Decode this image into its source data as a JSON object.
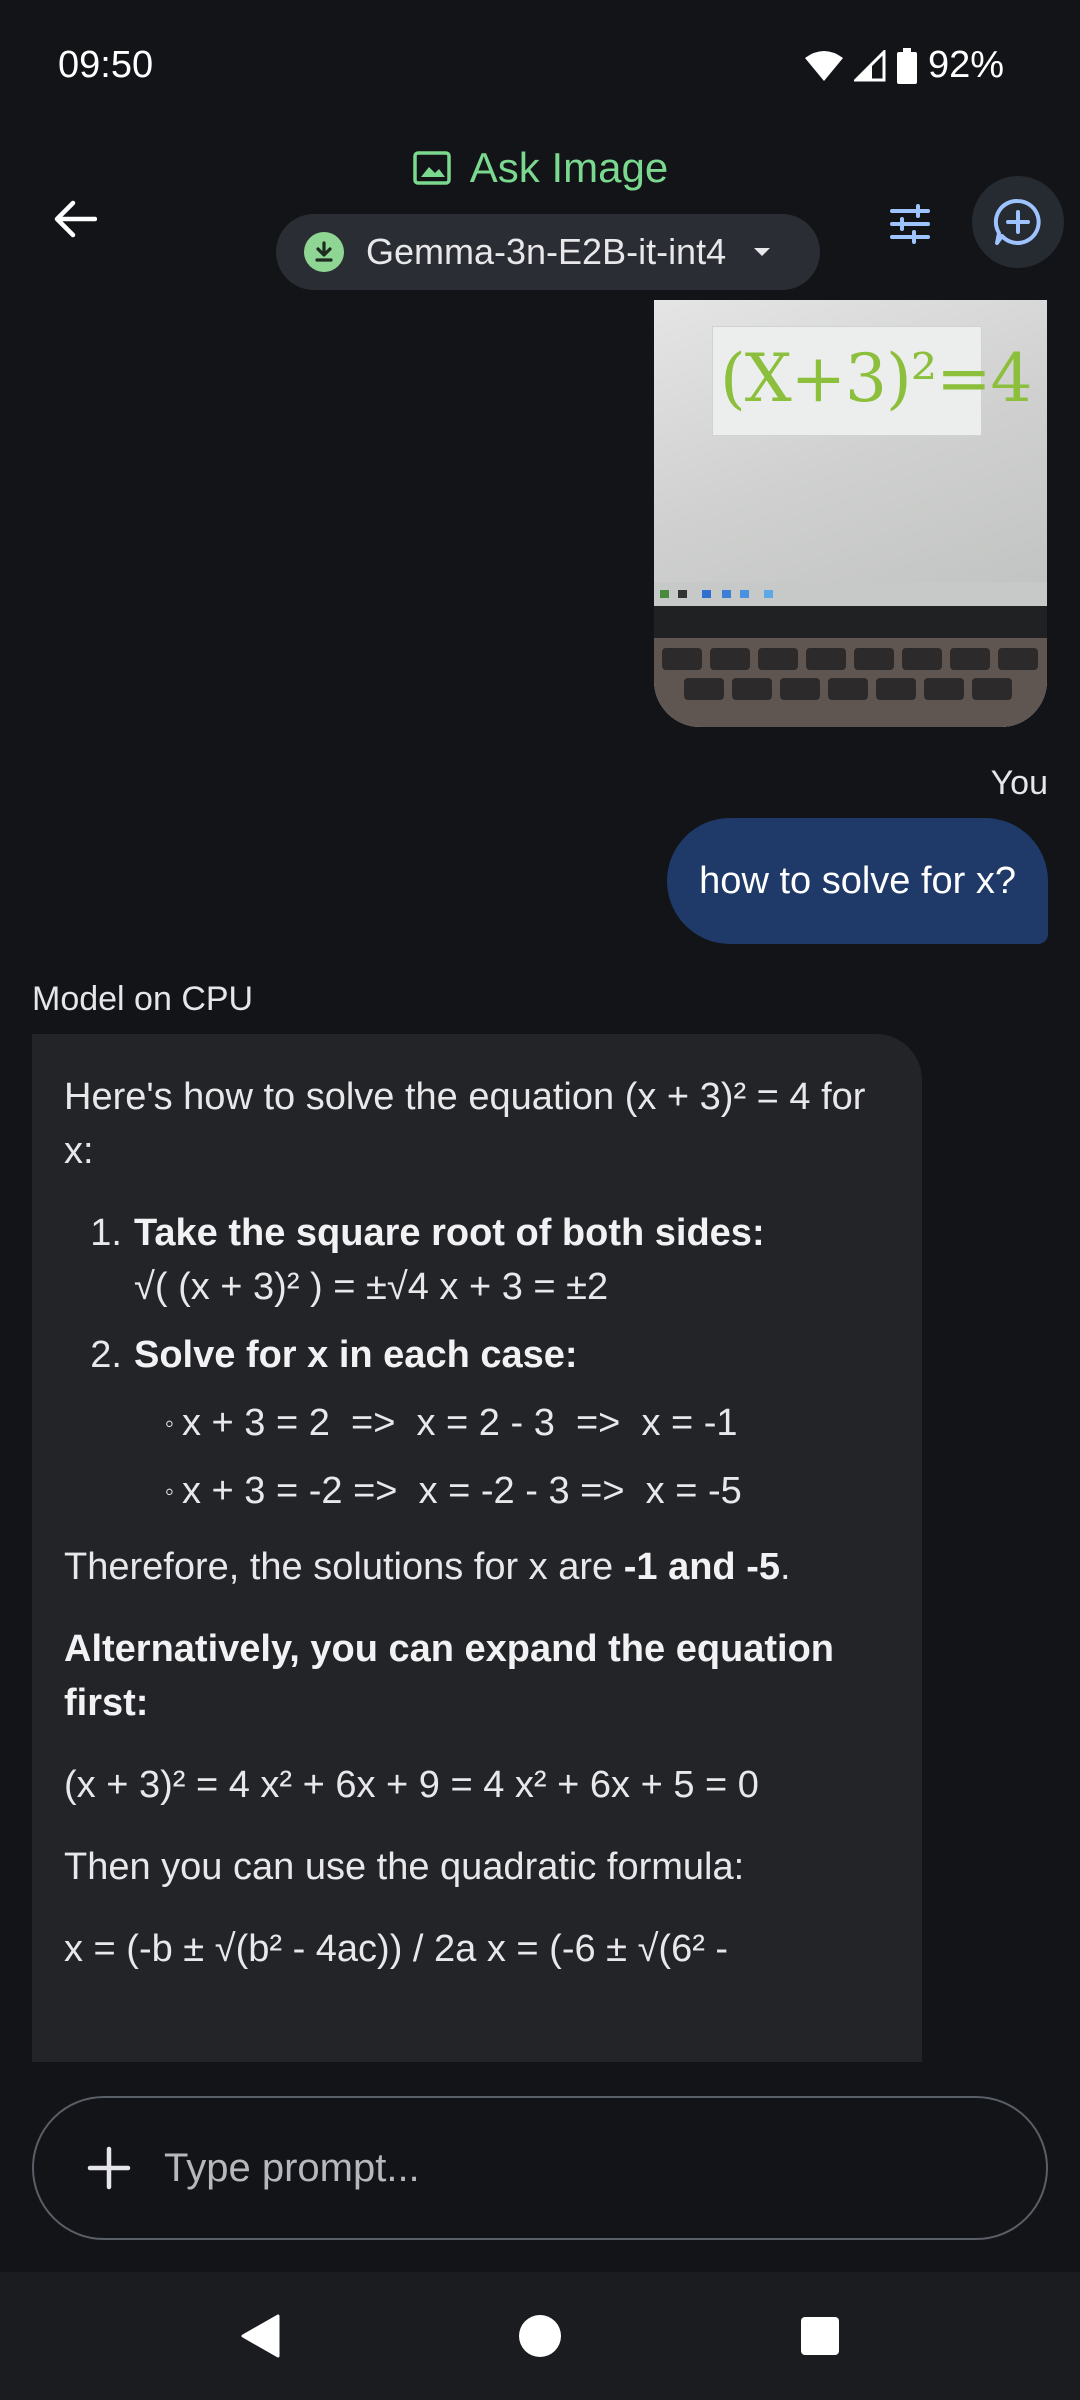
{
  "status": {
    "time": "09:50",
    "battery": "92%"
  },
  "header": {
    "title": "Ask Image",
    "model_name": "Gemma-3n-E2B-it-int4"
  },
  "chat": {
    "image_text": "(X+3)²=4",
    "you_label": "You",
    "user_message": "how to solve for x?",
    "model_label": "Model on CPU",
    "response": {
      "intro": "Here's how to solve the equation (x + 3)² = 4 for x:",
      "steps": [
        {
          "num": "1.",
          "title": "Take the square root of both sides:",
          "detail": "√( (x + 3)² ) = ±√4 x + 3 = ±2"
        },
        {
          "num": "2.",
          "title": "Solve for x in each case:",
          "subitems": [
            "x + 3 = 2  =>  x = 2 - 3  =>  x = -1",
            "x + 3 = -2 =>  x = -2 - 3 =>  x = -5"
          ]
        }
      ],
      "therefore_prefix": "Therefore, the solutions for x are ",
      "therefore_bold": "-1 and -5",
      "therefore_suffix": ".",
      "alt_heading": "Alternatively, you can expand the equation first:",
      "expand": "(x + 3)² = 4 x² + 6x + 9 = 4 x² + 6x + 5 = 0",
      "then": "Then you can use the quadratic formula:",
      "formula": "x = (-b ± √(b² - 4ac)) / 2a x = (-6 ± √(6² -"
    }
  },
  "input": {
    "placeholder": "Type prompt..."
  },
  "icons": {
    "back": "arrow-left-icon",
    "title": "image-icon",
    "download": "download-icon",
    "caret": "caret-down-icon",
    "tune": "tune-icon",
    "new_chat": "chat-add-icon",
    "plus": "plus-icon",
    "nav_back": "nav-back-icon",
    "nav_home": "nav-home-icon",
    "nav_recents": "nav-recents-icon"
  },
  "colors": {
    "accent": "#7bd88f",
    "user_bubble": "#1f3a68",
    "model_bubble": "#232427",
    "background": "#121418"
  }
}
